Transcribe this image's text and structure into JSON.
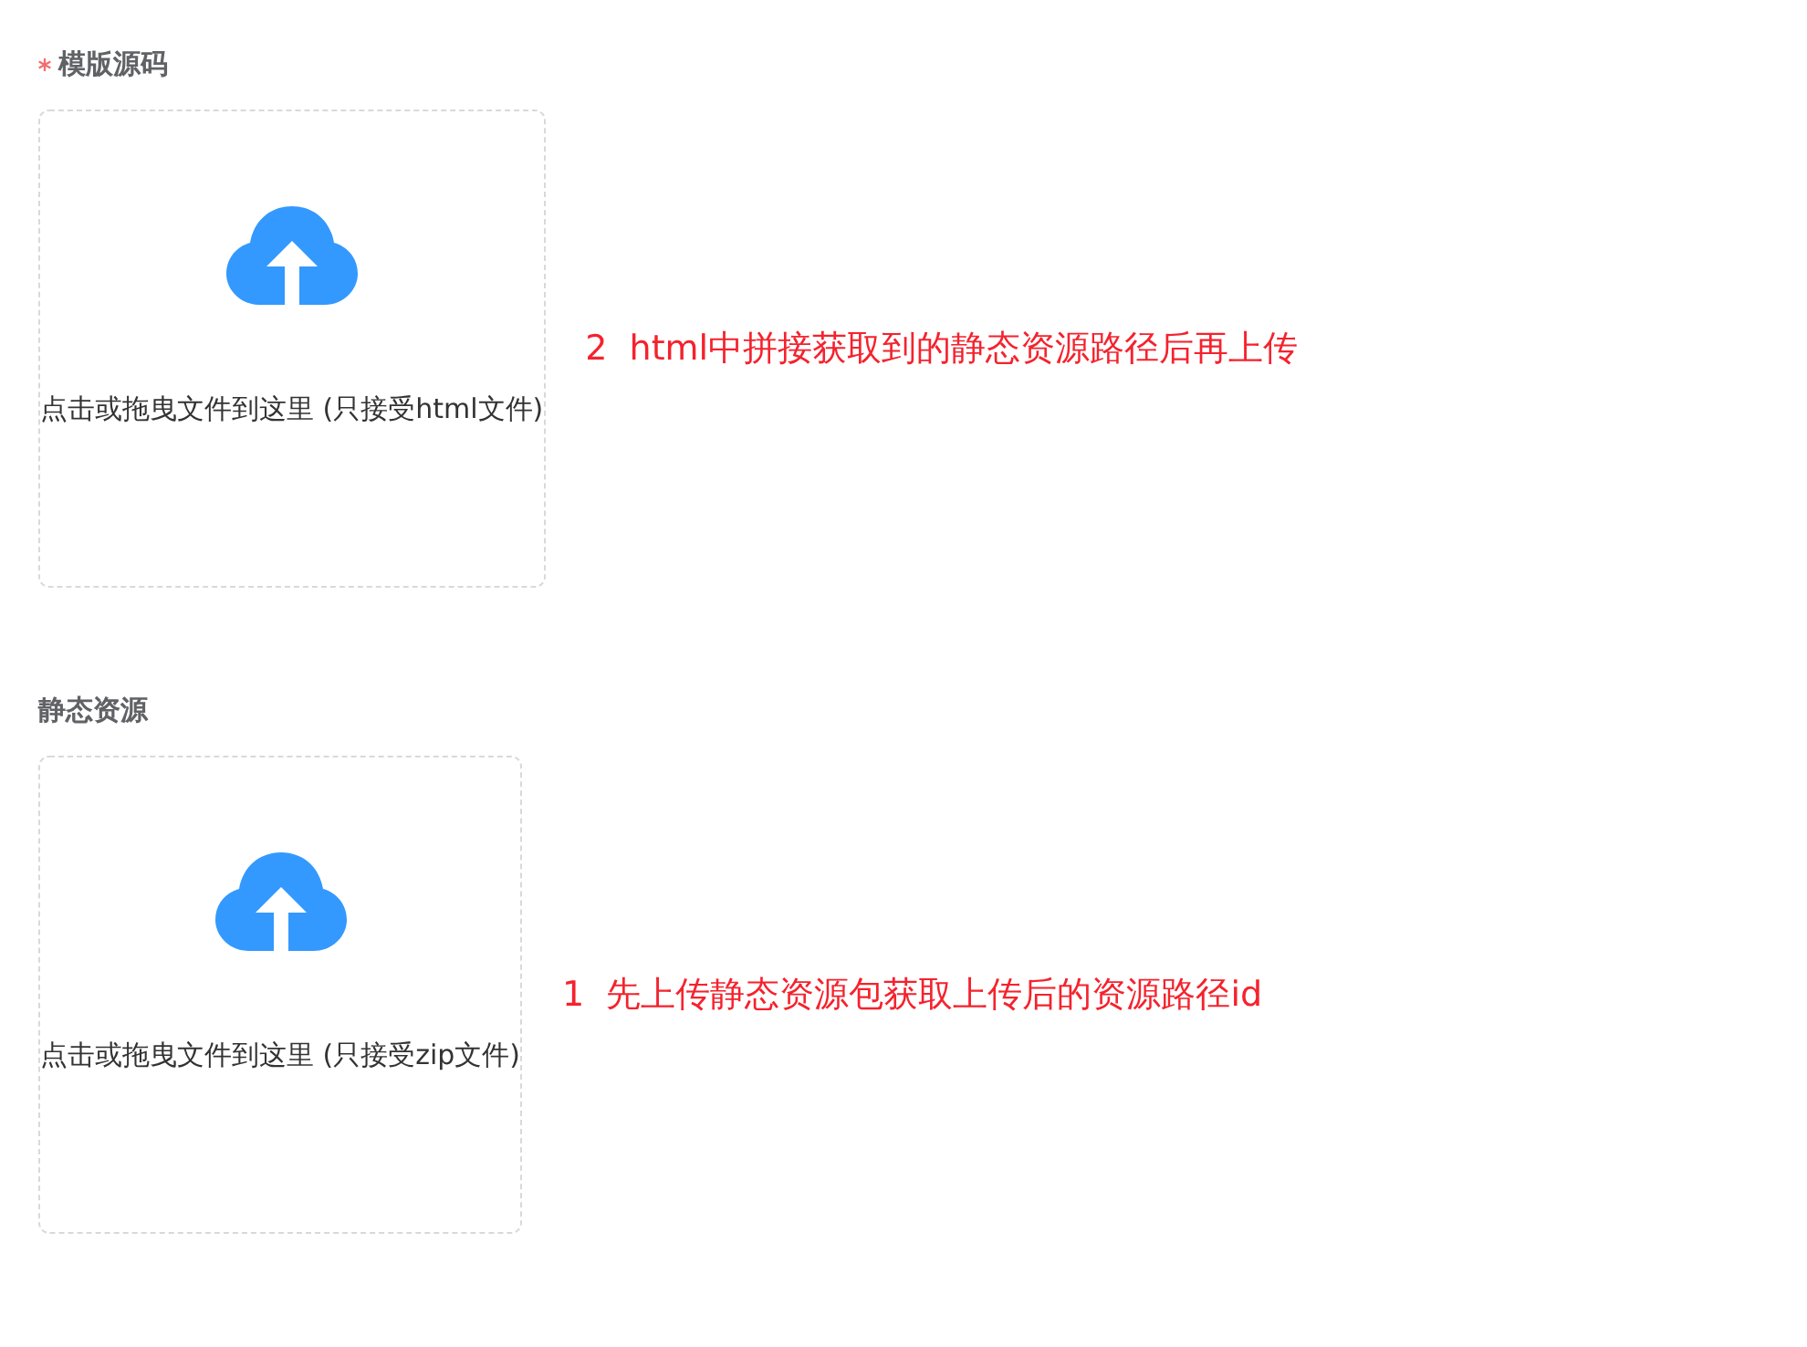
{
  "sections": [
    {
      "label": "模版源码",
      "required": true,
      "upload": {
        "hint": "点击或拖曳文件到这里 (只接受html文件)"
      },
      "note": "2  html中拼接获取到的静态资源路径后再上传"
    },
    {
      "label": "静态资源",
      "required": false,
      "upload": {
        "hint": "点击或拖曳文件到这里 (只接受zip文件)"
      },
      "note": "1  先上传静态资源包获取上传后的资源路径id"
    }
  ]
}
